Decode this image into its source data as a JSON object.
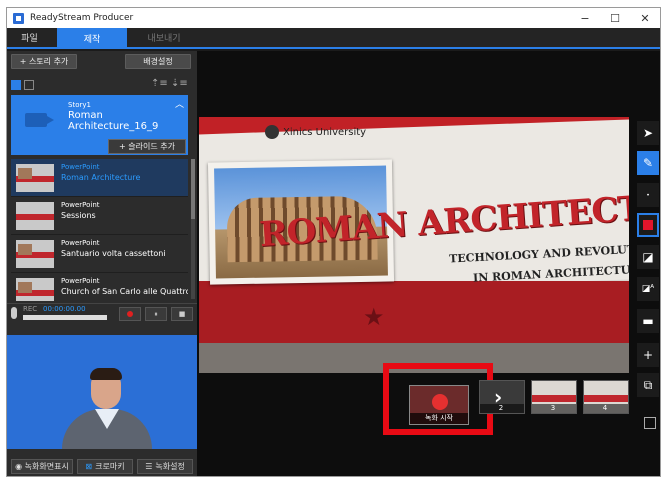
{
  "window": {
    "title": "ReadyStream Producer",
    "controls": [
      "−",
      "☐",
      "✕"
    ]
  },
  "tabs": [
    {
      "label": "파일"
    },
    {
      "label": "제작"
    },
    {
      "label": "내보내기"
    }
  ],
  "left": {
    "add_story": "+ 스토리 추가",
    "background": "배경설정",
    "story": {
      "small": "Story1",
      "title": "Roman Architecture_16_9"
    },
    "add_slide": "+ 슬라이드 추가",
    "slides": [
      {
        "type": "PowerPoint",
        "title": "Roman Architecture"
      },
      {
        "type": "PowerPoint",
        "title": "Sessions"
      },
      {
        "type": "PowerPoint",
        "title": "Santuario volta cassettoni"
      },
      {
        "type": "PowerPoint",
        "title": "Church of San Carlo alle Quattro"
      }
    ],
    "rec": {
      "label": "REC",
      "time": "00:00:00.00",
      "pause": "⏸",
      "stop": "■"
    },
    "bottom": {
      "screen": "◉ 녹화화면표시",
      "chroma": "크로마키",
      "settings": "녹화설정"
    }
  },
  "slide": {
    "university": "Xinics University",
    "title": "ROMAN ARCHITECTURE",
    "subtitle1": "TECHNOLOGY AND REVOLUTION",
    "subtitle2": "IN ROMAN ARCHITECTURE"
  },
  "tools": {
    "pointer": "pointer-icon",
    "pen": "pen-icon",
    "dot": "dot-icon",
    "color": "#e2152b",
    "eraser": "eraser-icon",
    "erase_all": "erase-all-icon",
    "board": "board-icon",
    "add": "+",
    "camera": "camera-icon"
  },
  "filmstrip": {
    "record_start": "녹화 시작",
    "frames": [
      "2",
      "3",
      "4"
    ]
  }
}
